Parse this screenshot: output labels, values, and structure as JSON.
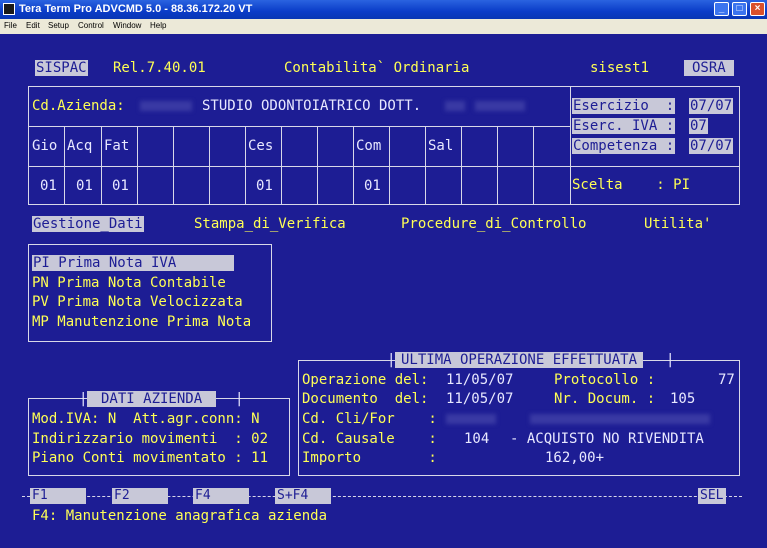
{
  "window": {
    "title": "Tera Term Pro ADVCMD 5.0 - 88.36.172.20 VT",
    "minimize_glyph": "_",
    "maximize_glyph": "□",
    "close_glyph": "×"
  },
  "menubar": [
    "File",
    "Edit",
    "Setup",
    "Control",
    "Window",
    "Help"
  ],
  "header": {
    "badge": "SISPAC",
    "release": "Rel.7.40.01",
    "module": "Contabilita` Ordinaria",
    "user": "sisest1",
    "code": "OSRA"
  },
  "azienda": {
    "label": "Cd.Azienda:",
    "name": "STUDIO ODONTOIATRICO DOTT."
  },
  "periods": {
    "esercizio_label": "Esercizio  :",
    "esercizio_value": "07/07",
    "esercizio_iva_label": "Eserc. IVA :",
    "esercizio_iva_value": "07",
    "competenza_label": "Competenza :",
    "competenza_value": "07/07",
    "scelta_label": "Scelta    : PI"
  },
  "grid": {
    "headers": [
      "Gio",
      "Acq",
      "Fat",
      "Ces",
      "Com",
      "Sal"
    ],
    "values": [
      "01",
      "01",
      "01",
      "01",
      "01"
    ]
  },
  "menu_tabs": [
    "Gestione_Dati",
    "Stampa_di_Verifica",
    "Procedure_di_Controllo",
    "Utilita'"
  ],
  "submenu": [
    "PI Prima Nota IVA",
    "PN Prima Nota Contabile",
    "PV Prima Nota Velocizzata",
    "MP Manutenzione Prima Nota"
  ],
  "dati_azienda": {
    "title": "DATI AZIENDA",
    "mod_iva": "Mod.IVA: N  Att.agr.conn: N",
    "indirizzario": "Indirizzario movimenti  : 02",
    "piano_conti": "Piano Conti movimentato : 11"
  },
  "ultima_operazione": {
    "title": "ULTIMA OPERAZIONE EFFETTUATA",
    "operazione_label": "Operazione del:",
    "operazione_date": "11/05/07",
    "protocollo_label": "Protocollo :",
    "protocollo_value": "77",
    "documento_label": "Documento  del:",
    "documento_date": "11/05/07",
    "nr_docum_label": "Nr. Docum. :",
    "nr_docum_value": "105",
    "cli_for_label": "Cd. Cli/For    :",
    "causale_label": "Cd. Causale    :",
    "causale_code": "104",
    "causale_desc": "- ACQUISTO NO RIVENDITA",
    "importo_label": "Importo        :",
    "importo_value": "162,00+"
  },
  "fkeys": [
    "F1",
    "F2",
    "F4",
    "S+F4",
    "SEL"
  ],
  "status_line": "F4: Manutenzione anagrafica azienda"
}
